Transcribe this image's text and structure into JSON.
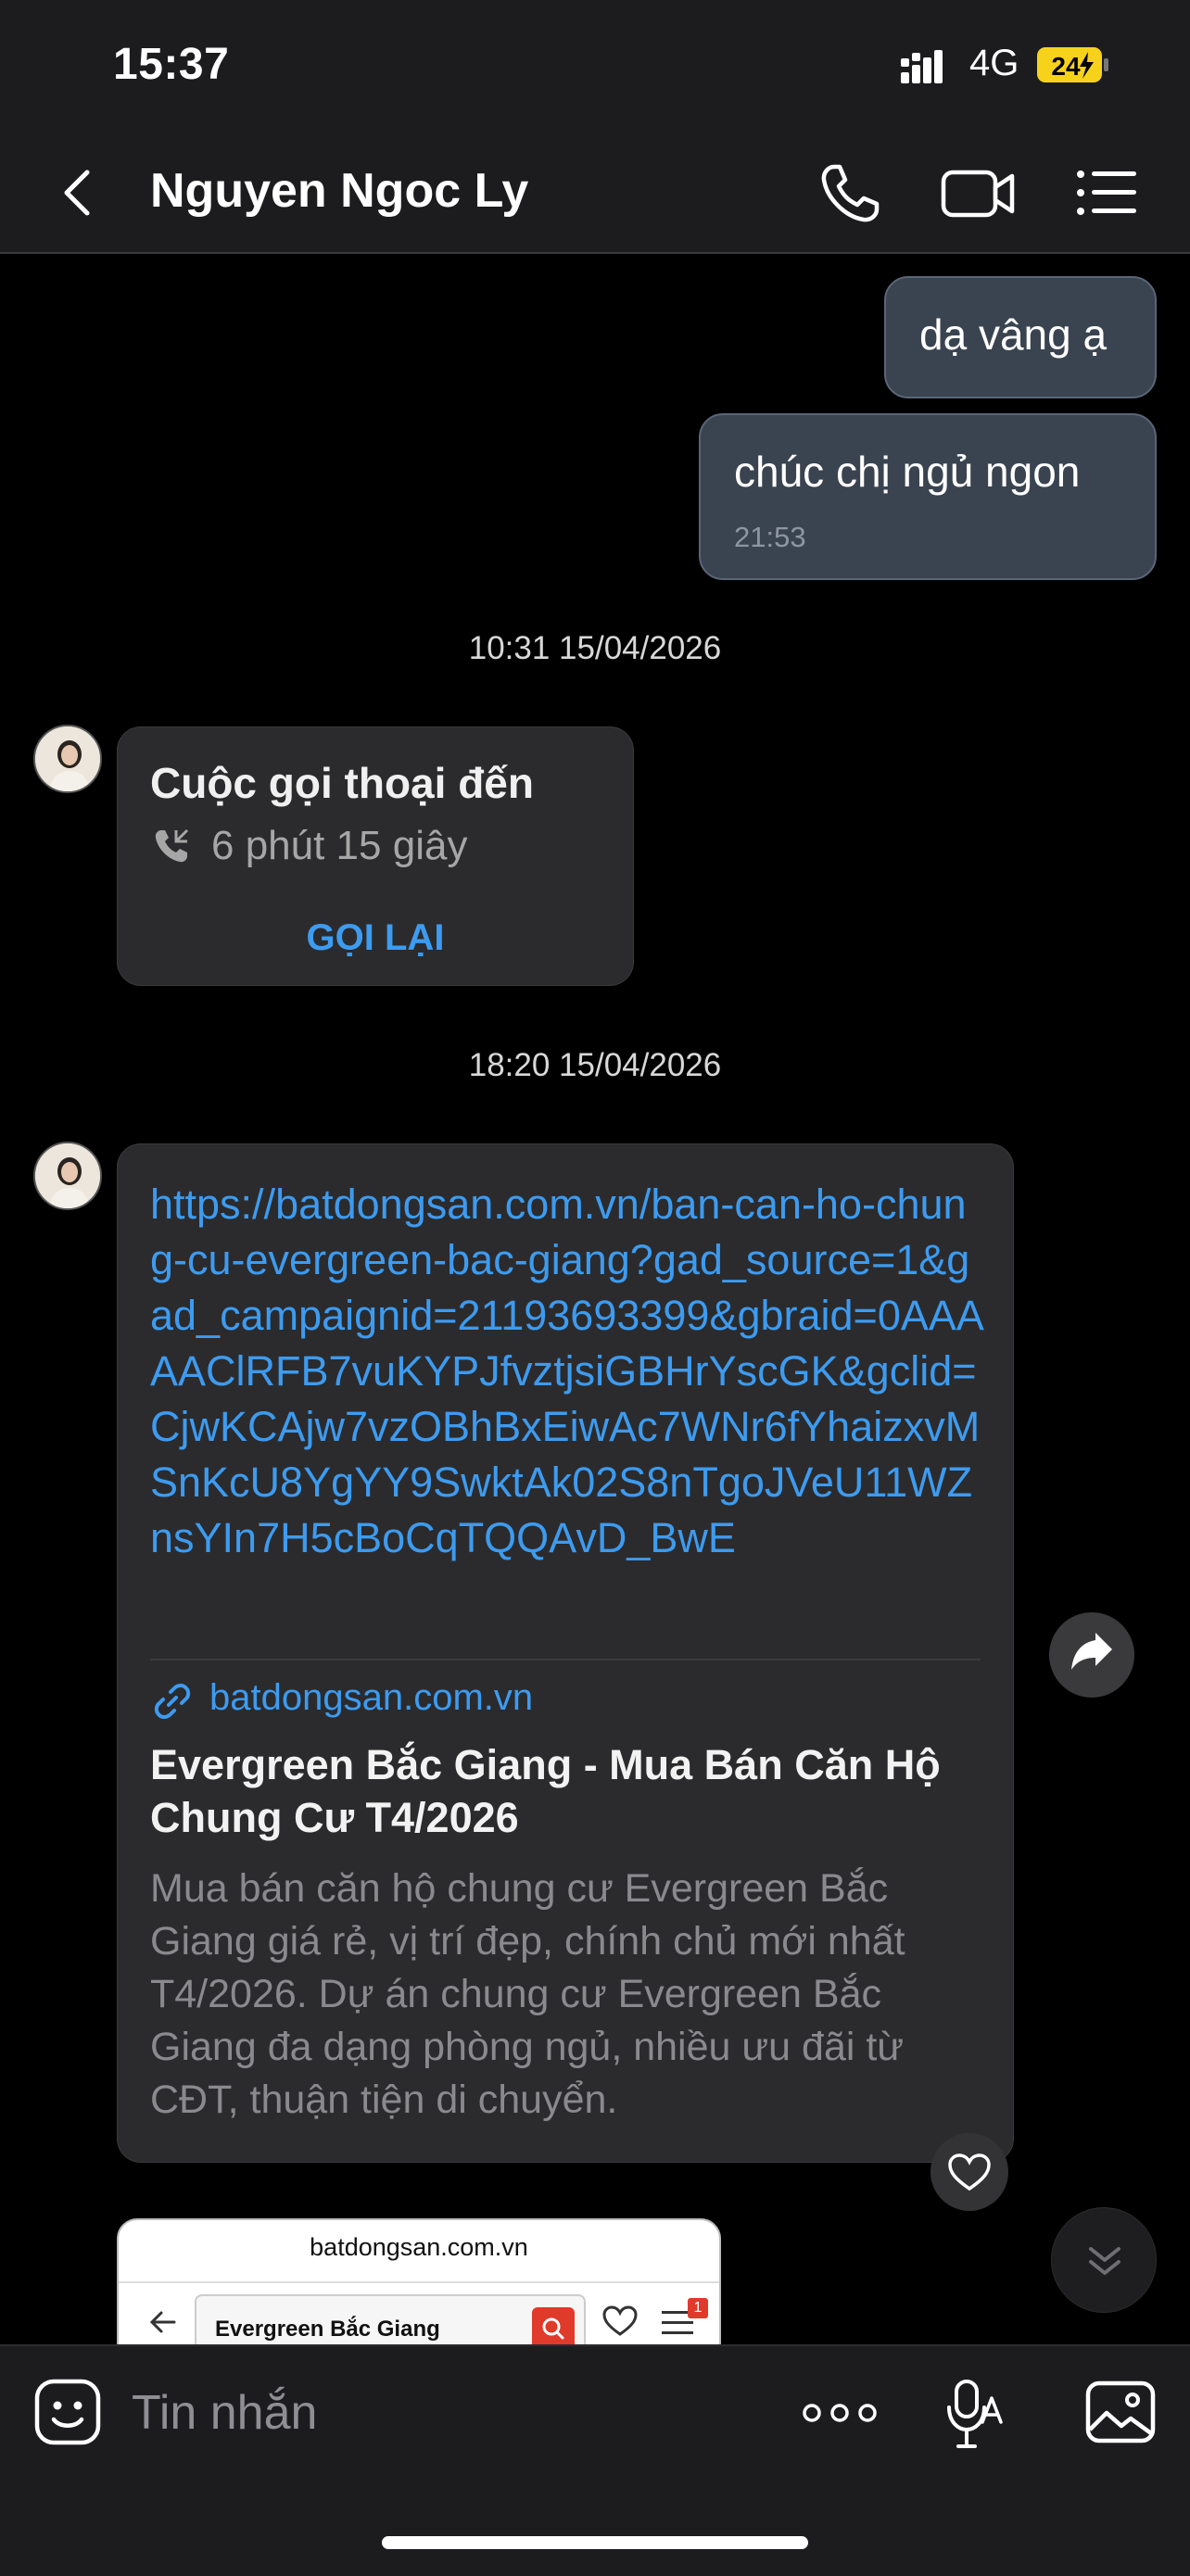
{
  "status_bar": {
    "time": "15:37",
    "network": "4G",
    "battery": "24"
  },
  "header": {
    "contact_name": "Nguyen Ngoc Ly"
  },
  "messages": {
    "sent_1": {
      "text": "dạ vâng ạ"
    },
    "sent_2": {
      "text": "chúc chị ngủ ngon",
      "time": "21:53"
    },
    "separator_1": "10:31 15/04/2026",
    "call": {
      "title": "Cuộc gọi thoại đến",
      "duration": "6 phút 15 giây",
      "action": "GỌI LẠI"
    },
    "separator_2": "18:20 15/04/2026",
    "link": {
      "url": "https://batdongsan.com.vn/ban-can-ho-chung-cu-evergreen-bac-giang?gad_source=1&gad_campaignid=21193693399&gbraid=0AAAAAClRFB7vuKYPJfvztjsiGBHrYscGK&gclid=CjwKCAjw7vzOBhBxEiwAc7WNr6fYhaizxvMSnKcU8YgYY9SwktAk02S8nTgoJVeU11WZnsYIn7H5cBoCqTQQAvD_BwE",
      "domain": "batdongsan.com.vn",
      "title": "Evergreen Bắc Giang - Mua Bán Căn Hộ Chung Cư T4/2026",
      "description": "Mua bán căn hộ chung cư Evergreen Bắc Giang giá rẻ, vị trí đẹp, chính chủ mới nhất T4/2026. Dự án chung cư Evergreen Bắc Giang đa dạng phòng ngủ, nhiều ưu đãi từ CĐT, thuận tiện di chuyển."
    },
    "preview": {
      "domain": "batdongsan.com.vn",
      "search_text": "Evergreen Bắc Giang",
      "badge": "1"
    }
  },
  "composer": {
    "placeholder": "Tin nhắn"
  },
  "colors": {
    "accent": "#3d9bf0",
    "sent_bubble": "#3a4350",
    "received_bubble": "#2b2b2d",
    "battery_fill": "#f7d21b"
  }
}
